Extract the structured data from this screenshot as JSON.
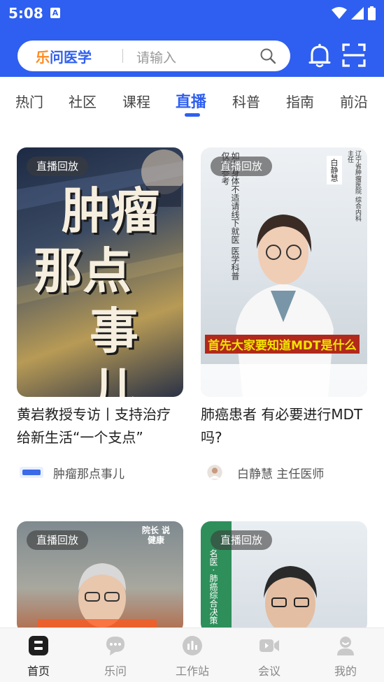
{
  "status_bar": {
    "time": "5:08",
    "notification_glyph": "A"
  },
  "header": {
    "brand": {
      "first_char": "乐",
      "rest": "问医学"
    },
    "search_placeholder": "请输入"
  },
  "tabs": [
    {
      "label": "热门"
    },
    {
      "label": "社区"
    },
    {
      "label": "课程"
    },
    {
      "label": "直播",
      "active": true
    },
    {
      "label": "科普"
    },
    {
      "label": "指南"
    },
    {
      "label": "前沿"
    }
  ],
  "cards": [
    {
      "tag": "直播回放",
      "title": "黄岩教授专访丨支持治疗 给新生活“一个支点”",
      "author": "肿瘤那点事儿",
      "thumb_text": [
        "肿瘤",
        "那点",
        "事儿"
      ]
    },
    {
      "tag": "直播回放",
      "title": "肺癌患者 有必要进行MDT吗?",
      "author": "白静慧 主任医师",
      "thumb_caption": "首先大家要知道MDT是什么",
      "thumb_side_text": "如有身体不适请线下就医",
      "thumb_side_text2": "医学科普仅供参考",
      "thumb_name_badge": "白静慧",
      "thumb_hospital": "辽宁省肿瘤医院 综合内科主任"
    },
    {
      "tag": "直播回放",
      "thumb_logo": "院长 说健康"
    },
    {
      "tag": "直播回放",
      "thumb_side": "名医 · 肺癌综合决策"
    }
  ],
  "bottom_nav": [
    {
      "label": "首页",
      "icon": "home-icon",
      "active": true
    },
    {
      "label": "乐问",
      "icon": "chat-icon"
    },
    {
      "label": "工作站",
      "icon": "workstation-icon"
    },
    {
      "label": "会议",
      "icon": "video-icon"
    },
    {
      "label": "我的",
      "icon": "profile-icon"
    }
  ],
  "colors": {
    "accent": "#2f5ff0",
    "brand_orange": "#ff8a1e",
    "caption_yellow": "#f2e300"
  }
}
